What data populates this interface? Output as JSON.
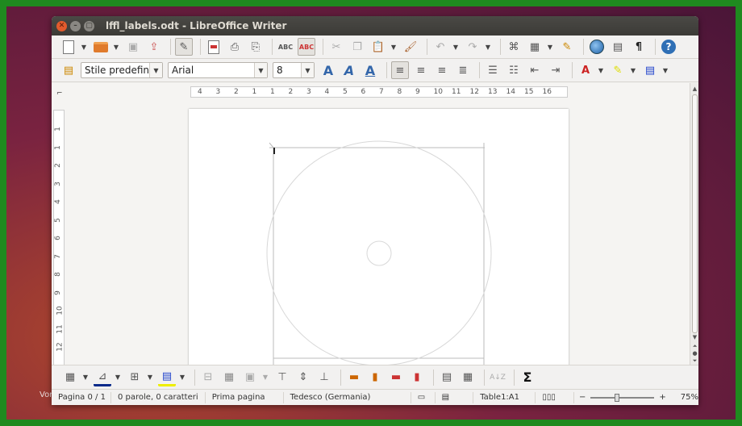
{
  "window": {
    "title": "lffl_labels.odt - LibreOffice Writer"
  },
  "toolbar_format": {
    "paragraph_style": "Stile predefini",
    "font_name": "Arial",
    "font_size": "8"
  },
  "ruler": {
    "horizontal_ticks": [
      "4",
      "3",
      "2",
      "1",
      "1",
      "2",
      "3",
      "4",
      "5",
      "6",
      "7",
      "8",
      "9",
      "10",
      "11",
      "12",
      "13",
      "14",
      "15",
      "16"
    ],
    "vertical_ticks": [
      "1",
      "1",
      "2",
      "3",
      "4",
      "5",
      "6",
      "7",
      "8",
      "9",
      "10",
      "11",
      "12"
    ]
  },
  "statusbar": {
    "page": "Pagina 0 / 1",
    "words": "0 parole, 0 caratteri",
    "page_style": "Prima pagina",
    "language": "Tedesco (Germania)",
    "table_cell": "Table1:A1",
    "zoom": "75%"
  },
  "watermark": "Vorla",
  "colors": {
    "accent": "#2f6fb5",
    "titlebar": "#3c3b37",
    "border": "#1f8a1f"
  },
  "icons": {
    "standard": [
      "new-icon",
      "open-icon",
      "save-icon",
      "export-icon",
      "edit-icon",
      "pdf-icon",
      "print-icon",
      "print-preview-icon",
      "spellcheck-icon",
      "autocheck-icon",
      "cut-icon",
      "copy-icon",
      "paste-icon",
      "clone-icon",
      "undo-icon",
      "redo-icon",
      "navigator-icon",
      "table-icon",
      "draw-icon",
      "gallery-icon",
      "frame-icon",
      "pilcrow-icon",
      "help-icon"
    ]
  },
  "symbols": {
    "sigma": "Σ",
    "pilcrow": "¶",
    "help": "?"
  }
}
